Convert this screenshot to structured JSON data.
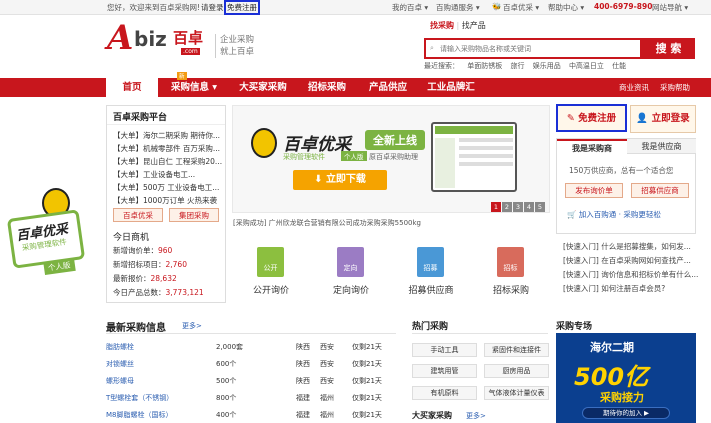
{
  "topbar": {
    "welcome": "您好，欢迎来到百卓采购网!",
    "login": "请登录",
    "register": "免费注册",
    "my_abiz": "我的百卓 ▾",
    "mall": "百购通服务 ▾",
    "youcai": "百卓优采 ▾",
    "help": "帮助中心 ▾",
    "phone": "400-6979-890",
    "sitemap": "网站导航 ▾"
  },
  "header": {
    "logo_a": "A",
    "logo_biz": "biz",
    "logo_cn": "百卓",
    "logo_dotcom": ".com",
    "slogan_1": "企业采购",
    "slogan_2": "就上百卓",
    "search_tab_buy": "找采购",
    "search_tab_sell": "找产品",
    "search_placeholder": "请输入采购物品名称或关键词",
    "search_button": "搜 索",
    "hot_words": [
      "最近搜索：",
      "单面防锈板",
      "旅行",
      "娱乐用品",
      "中高温日立",
      "仕能"
    ]
  },
  "nav": {
    "items": [
      "首页",
      "采购信息 ▾",
      "大买家采购",
      "招标采购",
      "产品供应",
      "工业品牌汇"
    ],
    "new_badge": "新",
    "right_1": "商业资讯",
    "right_2": "采购帮助"
  },
  "platform": {
    "title": "百卓采购平台",
    "news": [
      "【大单】海尔二期采购 期待你...",
      "【大单】机械零部件 百万采购...",
      "【大单】昆山自仁 工程采购20...",
      "【大单】工业设备电工...",
      "【大单】500万 工业设备电工...",
      "【大单】1000万订单 火热来袭"
    ],
    "btn_youcai": "百卓优采",
    "btn_group": "集团采购",
    "today_title": "今日商机",
    "stats": [
      {
        "label": "新增询价单：",
        "value": "960"
      },
      {
        "label": "新增招标项目：",
        "value": "2,760"
      },
      {
        "label": "最新报价：",
        "value": "28,632"
      },
      {
        "label": "今日产品总数：",
        "value": "3,773,121"
      }
    ]
  },
  "promo": {
    "brand": "百卓优采",
    "sub": "采购管理软件",
    "personal": "个人版",
    "badge": "全新上线",
    "assistant": "原百卓采购助理",
    "download": "立即下载",
    "pages": [
      "1",
      "2",
      "3",
      "4",
      "5"
    ],
    "ticker": "[采购成功] 广州欣龙联合营销有限公司成功采购采购5500kg"
  },
  "tiles": [
    {
      "icon": "公开",
      "label": "公开询价",
      "color": "#8cbf3f"
    },
    {
      "icon": "定向",
      "label": "定向询价",
      "color": "#9b7cc4"
    },
    {
      "icon": "招募",
      "label": "招募供应商",
      "color": "#4a98d6"
    },
    {
      "icon": "招标",
      "label": "招标采购",
      "color": "#d86b5c"
    }
  ],
  "side": {
    "brand": "百卓优采",
    "sub": "采购管理软件",
    "personal": "个人版"
  },
  "account": {
    "register": "免费注册",
    "login": "立即登录",
    "tab_buyer": "我是采购商",
    "tab_seller": "我是供应商",
    "supply_text": "150万供应商，总有一个适合您",
    "btn_publish": "发布询价单",
    "btn_recruit": "招募供应商",
    "join_mall": "加入百购通 · 采购更轻松",
    "links": [
      "[快速入门] 什么是招募搜集，如何发...",
      "[快速入门] 在百卓采购网如何查找产...",
      "[快速入门] 询价信息和招标价单有什么...",
      "[快速入门] 如何注册百卓会员?"
    ]
  },
  "latest": {
    "title": "最新采购信息",
    "more": "更多>",
    "rows": [
      {
        "name": "脂肪螺栓",
        "qty": "2,000套",
        "prov": "陕西",
        "city": "西安",
        "days": "仅剩21天"
      },
      {
        "name": "对锁螺丝",
        "qty": "600个",
        "prov": "陕西",
        "city": "西安",
        "days": "仅剩21天"
      },
      {
        "name": "螺形螺母",
        "qty": "500个",
        "prov": "陕西",
        "city": "西安",
        "days": "仅剩21天"
      },
      {
        "name": "T型螺栓套（不锈钢）",
        "qty": "800个",
        "prov": "福建",
        "city": "福州",
        "days": "仅剩21天"
      },
      {
        "name": "M8脚脂螺栓（国标）",
        "qty": "400个",
        "prov": "福建",
        "city": "福州",
        "days": "仅剩21天"
      }
    ]
  },
  "hotbuy": {
    "title": "热门采购",
    "tags": [
      "手动工具",
      "紧固件和连接件",
      "建筑用管",
      "厨房用品",
      "有机原料",
      "气体液体计量仪表"
    ],
    "big_buyer": "大买家采购",
    "more": "更多>"
  },
  "special": {
    "title": "采购专场",
    "line1": "海尔二期",
    "line2": "500亿",
    "line3": "采购接力",
    "line4": "期待你的加入 ▶"
  }
}
